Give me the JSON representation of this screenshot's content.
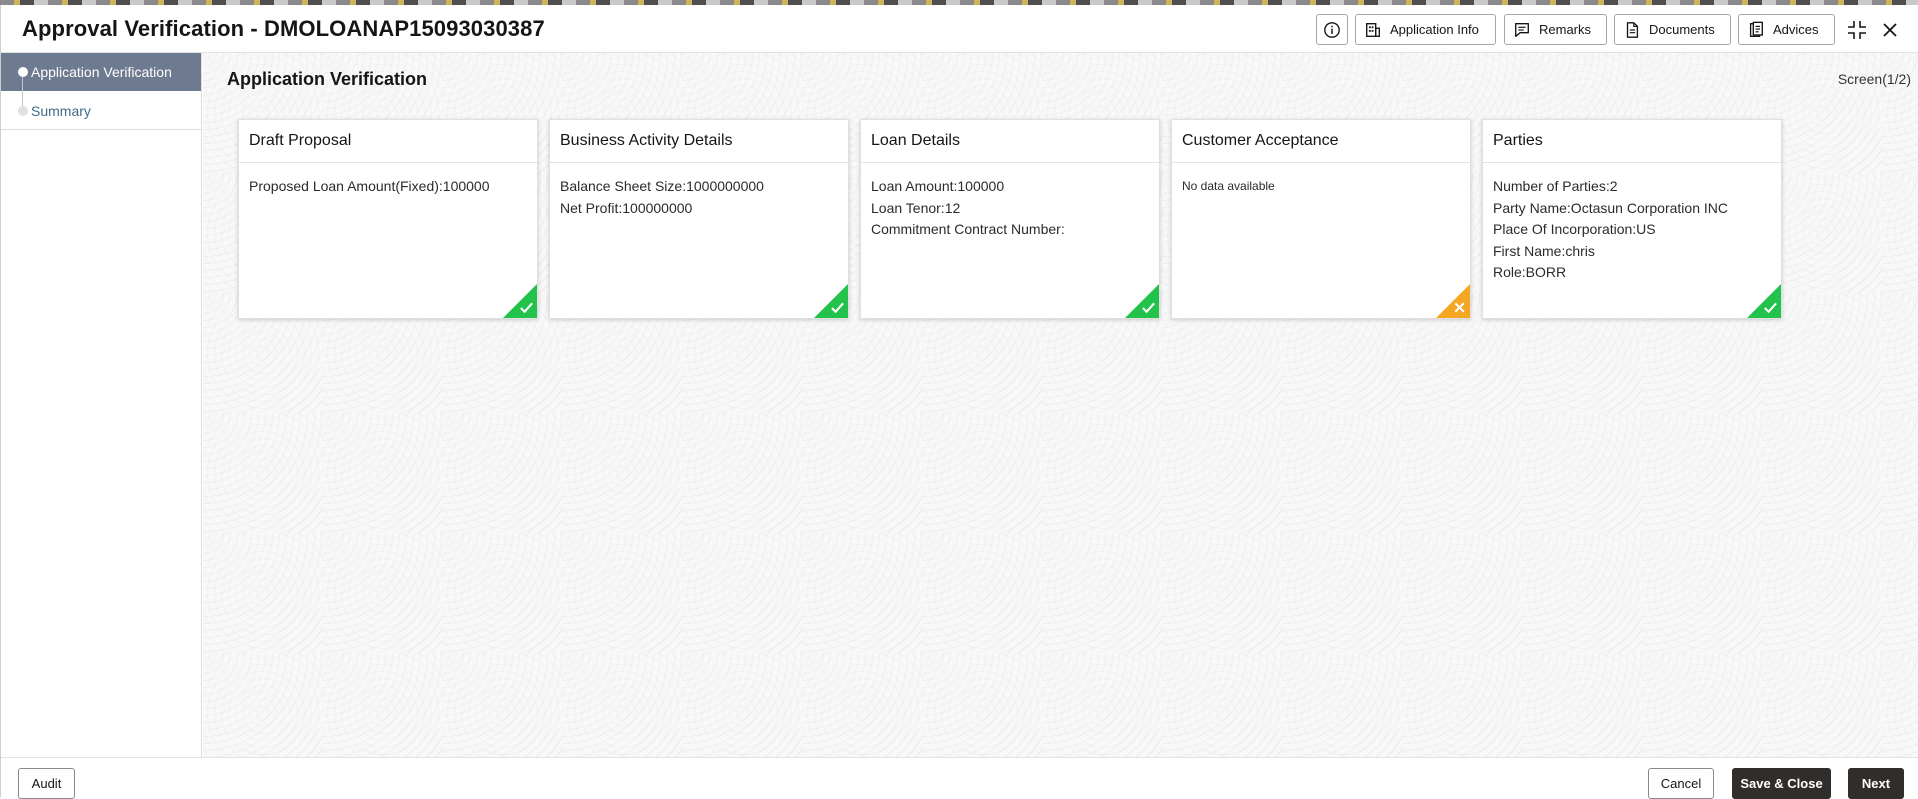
{
  "header": {
    "title": "Approval Verification - DMOLOANAP15093030387",
    "buttons": {
      "application_info": "Application Info",
      "remarks": "Remarks",
      "documents": "Documents",
      "advices": "Advices"
    }
  },
  "sidebar": {
    "items": [
      {
        "label": "Application Verification",
        "active": true
      },
      {
        "label": "Summary",
        "active": false
      }
    ]
  },
  "main": {
    "title": "Application Verification",
    "screen_counter": "Screen(1/2)",
    "cards": [
      {
        "title": "Draft Proposal",
        "lines": [
          "Proposed Loan Amount(Fixed):100000"
        ],
        "status": "complete"
      },
      {
        "title": "Business Activity Details",
        "lines": [
          "Balance Sheet Size:1000000000",
          "Net Profit:100000000"
        ],
        "status": "complete"
      },
      {
        "title": "Loan Details",
        "lines": [
          "Loan Amount:100000",
          "Loan Tenor:12",
          "Commitment Contract Number:"
        ],
        "status": "complete"
      },
      {
        "title": "Customer Acceptance",
        "lines": [],
        "no_data": "No data available",
        "status": "incomplete"
      },
      {
        "title": "Parties",
        "lines": [
          "Number of Parties:2",
          "Party Name:Octasun Corporation INC",
          "Place Of Incorporation:US",
          "First Name:chris",
          "Role:BORR"
        ],
        "status": "complete"
      }
    ]
  },
  "footer": {
    "audit": "Audit",
    "cancel": "Cancel",
    "save_close": "Save & Close",
    "next": "Next"
  },
  "colors": {
    "status_complete": "#23c34b",
    "status_incomplete": "#f5a623",
    "nav_active": "#6e7a8f",
    "primary_button": "#312d2a"
  }
}
